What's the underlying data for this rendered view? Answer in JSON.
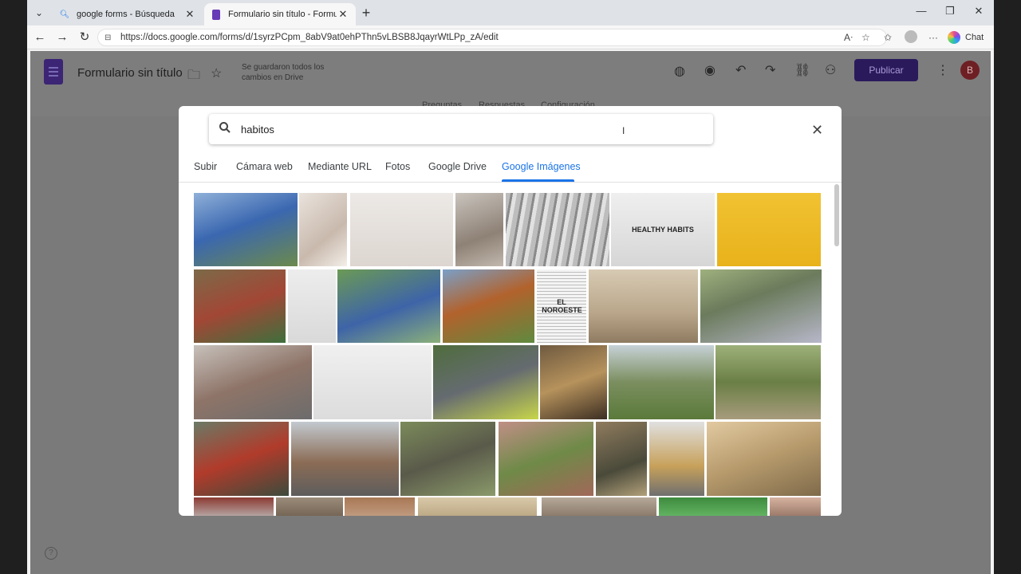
{
  "browser": {
    "tabs": [
      {
        "title": "google forms - Búsqueda",
        "active": false
      },
      {
        "title": "Formulario sin título - Formularios",
        "active": true
      }
    ],
    "url": "https://docs.google.com/forms/d/1syrzPCpm_8abV9at0ehPThn5vLBSB8JqayrWtLPp_zA/edit",
    "chat_label": "Chat"
  },
  "forms": {
    "title": "Formulario sin título",
    "saved_status": "Se guardaron todos los cambios en Drive",
    "publish_label": "Publicar",
    "avatar_letter": "B",
    "tabs": [
      "Preguntas",
      "Respuestas",
      "Configuración"
    ],
    "accent_color": "#673ab7"
  },
  "dialog": {
    "search_value": "habitos",
    "tabs": [
      "Subir",
      "Cámara web",
      "Mediante URL",
      "Fotos",
      "Google Drive",
      "Google Imágenes"
    ],
    "active_tab": "Google Imágenes",
    "accent_color": "#1a73e8",
    "results": [
      {
        "desc": "Personas con camisetas azules"
      },
      {
        "desc": "Persona en la cama"
      },
      {
        "desc": "Healthy habits cartel"
      },
      {
        "desc": "Personas mayores"
      },
      {
        "desc": "Periódico antiguo"
      },
      {
        "desc": "Notas healthy habits",
        "text": "HEALTHY HABITS"
      },
      {
        "desc": "Persona con cartel healthy habits"
      },
      {
        "desc": "Cestas de colores"
      },
      {
        "desc": "Mujer con notas"
      },
      {
        "desc": "Grupo al aire libre"
      },
      {
        "desc": "Huerto urbano"
      },
      {
        "desc": "Periódico El Noroeste",
        "text": "EL NOROESTE"
      },
      {
        "desc": "Pescador en la playa"
      },
      {
        "desc": "Multitud en parque"
      },
      {
        "desc": "Calle con edificios"
      },
      {
        "desc": "Mujer con notas de hábitos"
      },
      {
        "desc": "Trabajador junto a cabina"
      },
      {
        "desc": "Comida en mesa de madera"
      },
      {
        "desc": "Huerto con plantas"
      },
      {
        "desc": "Personas en jardín"
      },
      {
        "desc": "Cabina roja en la calle"
      },
      {
        "desc": "Edificio en esquina"
      },
      {
        "desc": "Macetas con neumáticos"
      },
      {
        "desc": "Invernadero"
      },
      {
        "desc": "Hombre pensativo"
      },
      {
        "desc": "Stand de exposición"
      },
      {
        "desc": "Fotografía antigua de puerto"
      },
      {
        "desc": "Fila inferior 1"
      },
      {
        "desc": "Fila inferior 2"
      },
      {
        "desc": "Fila inferior 3"
      },
      {
        "desc": "Fila inferior 4"
      },
      {
        "desc": "Fila inferior 5"
      },
      {
        "desc": "Fila inferior 6"
      },
      {
        "desc": "Fila inferior 7"
      }
    ]
  }
}
